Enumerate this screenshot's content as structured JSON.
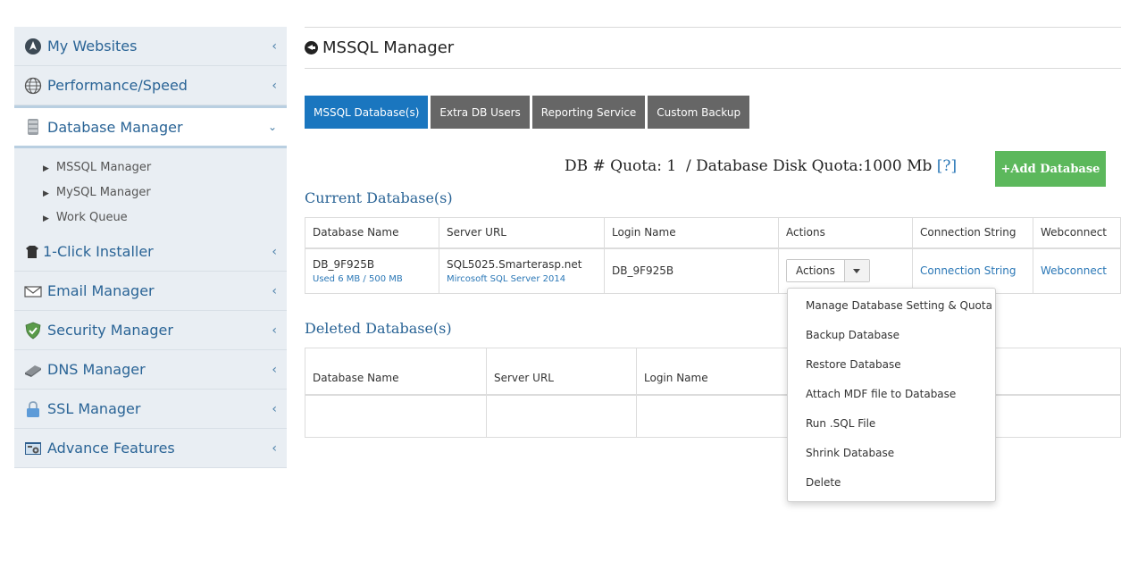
{
  "sidebar": {
    "items": [
      {
        "label": "My Websites",
        "icon": "nav-compass-icon"
      },
      {
        "label": "Performance/Speed",
        "icon": "globe-icon"
      },
      {
        "label": "Database Manager",
        "icon": "database-icon"
      },
      {
        "label": "1-Click Installer",
        "icon": "installer-icon"
      },
      {
        "label": "Email Manager",
        "icon": "envelope-icon"
      },
      {
        "label": "Security Manager",
        "icon": "shield-icon"
      },
      {
        "label": "DNS Manager",
        "icon": "dns-icon"
      },
      {
        "label": "SSL Manager",
        "icon": "lock-icon"
      },
      {
        "label": "Advance Features",
        "icon": "tools-icon"
      }
    ],
    "submenu": [
      "MSSQL Manager",
      "MySQL Manager",
      "Work Queue"
    ]
  },
  "page": {
    "title": "MSSQL Manager"
  },
  "tabs": [
    {
      "label": "MSSQL Database(s)"
    },
    {
      "label": "Extra DB Users"
    },
    {
      "label": "Reporting Service"
    },
    {
      "label": "Custom Backup"
    }
  ],
  "quota": {
    "text": "DB # Quota: 1  / Database Disk Quota:1000 Mb ",
    "help": "[?]"
  },
  "add_database_label": "+Add Database",
  "current": {
    "title": "Current Database(s)",
    "headers": [
      "Database Name",
      "Server URL",
      "Login Name",
      "Actions",
      "Connection String",
      "Webconnect"
    ],
    "row": {
      "db_name": "DB_9F925B",
      "usage": "Used 6 MB / 500 MB",
      "server_url": "SQL5025.Smarterasp.net",
      "server_version": "Mircosoft SQL Server 2014",
      "login_name": "DB_9F925B",
      "actions_label": "Actions",
      "connection_string": "Connection String",
      "webconnect": "Webconnect"
    }
  },
  "deleted": {
    "title": "Deleted Database(s)",
    "headers": [
      "Database Name",
      "Server URL",
      "Login Name"
    ]
  },
  "actions_menu": [
    "Manage Database Setting & Quota",
    "Backup Database",
    "Restore Database",
    "Attach MDF file to Database",
    "Run .SQL File",
    "Shrink Database",
    "Delete"
  ],
  "colors": {
    "active_tab": "#1a76bf",
    "tab": "#666666",
    "add_button": "#5cb85c",
    "link": "#2a77b6"
  }
}
